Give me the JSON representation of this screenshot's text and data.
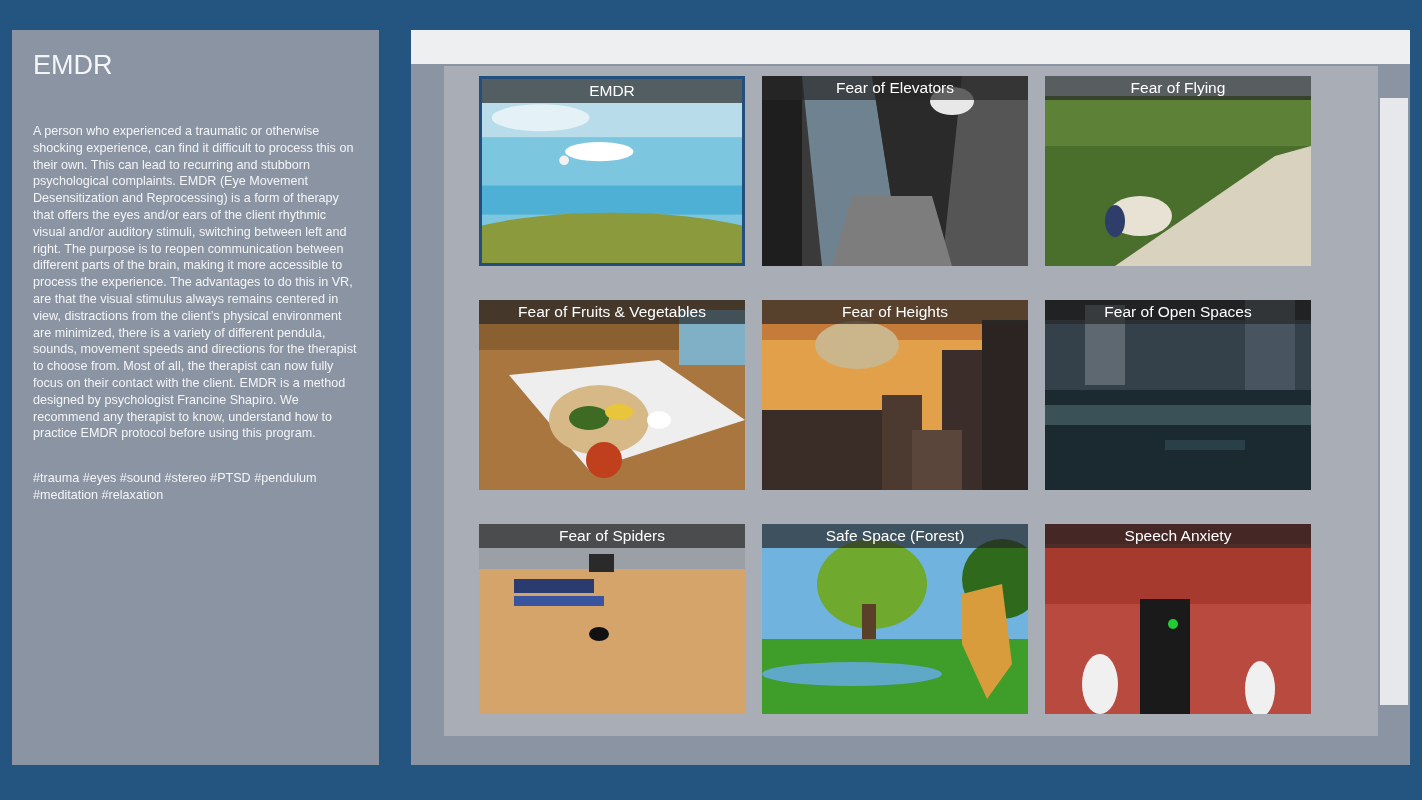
{
  "info_panel": {
    "title": "EMDR",
    "description": "A person who experienced a traumatic or otherwise shocking experience, can find it difficult to process this on their own. This can lead to recurring and stubborn psychological complaints. EMDR (Eye Movement Desensitization and Reprocessing) is a form of therapy that offers the eyes and/or ears of the client rhythmic visual and/or auditory stimuli, switching between left and right. The purpose is to reopen communication between different parts of the brain, making it more accessible to process the experience. The advantages to do this in VR, are that the visual stimulus always remains centered in view, distractions from the client’s physical environment are minimized, there is a variety of different pendula, sounds, movement speeds and directions for the therapist to choose from. Most of all, the therapist can now fully focus on their contact with the client. EMDR is a method designed by psychologist Francine Shapiro. We recommend any therapist to know, understand how to practice EMDR protocol before using this program.",
    "tags": "#trauma #eyes #sound #stereo #PTSD #pendulum #meditation #relaxation"
  },
  "scenarios": [
    {
      "title": "EMDR",
      "selected": true
    },
    {
      "title": "Fear of Elevators",
      "selected": false
    },
    {
      "title": "Fear of Flying",
      "selected": false
    },
    {
      "title": "Fear of Fruits & Vegetables",
      "selected": false
    },
    {
      "title": "Fear of Heights",
      "selected": false
    },
    {
      "title": "Fear of Open Spaces",
      "selected": false
    },
    {
      "title": "Fear of Spiders",
      "selected": false
    },
    {
      "title": "Safe Space (Forest)",
      "selected": false
    },
    {
      "title": "Speech Anxiety",
      "selected": false
    }
  ]
}
